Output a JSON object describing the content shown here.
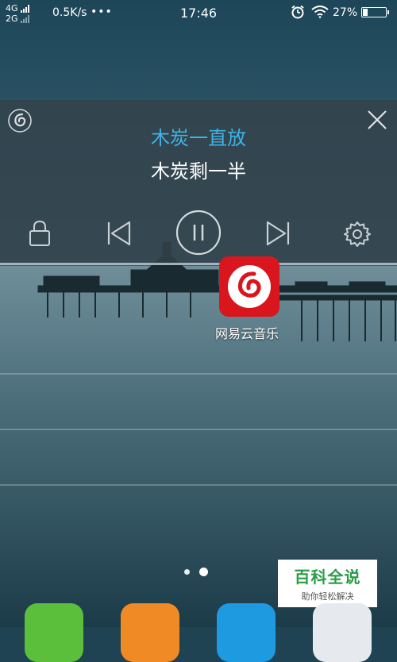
{
  "status_bar": {
    "network_top": "4G",
    "network_bottom": "2G",
    "speed": "0.5K/s",
    "dots": "•••",
    "time": "17:46",
    "battery": "27%",
    "battery_level": 0.27
  },
  "music_panel": {
    "title": "木炭一直放",
    "subtitle": "木炭剩一半",
    "title_color": "#3fb3e6",
    "controls": [
      "lock-icon",
      "previous-icon",
      "pause-icon",
      "next-icon",
      "settings-icon"
    ]
  },
  "app_icon": {
    "label": "网易云音乐",
    "color": "#d9161d"
  },
  "pager": {
    "pages": 2,
    "active": 1
  },
  "watermark": {
    "main": "百科全说",
    "sub": "助你轻松解决"
  },
  "dock": {
    "icons": [
      "phone-icon",
      "contacts-icon",
      "messages-icon",
      "browser-icon"
    ],
    "colors": [
      "#5cbf3b",
      "#f08a24",
      "#1e9ae0",
      "#e6e9ee"
    ]
  }
}
